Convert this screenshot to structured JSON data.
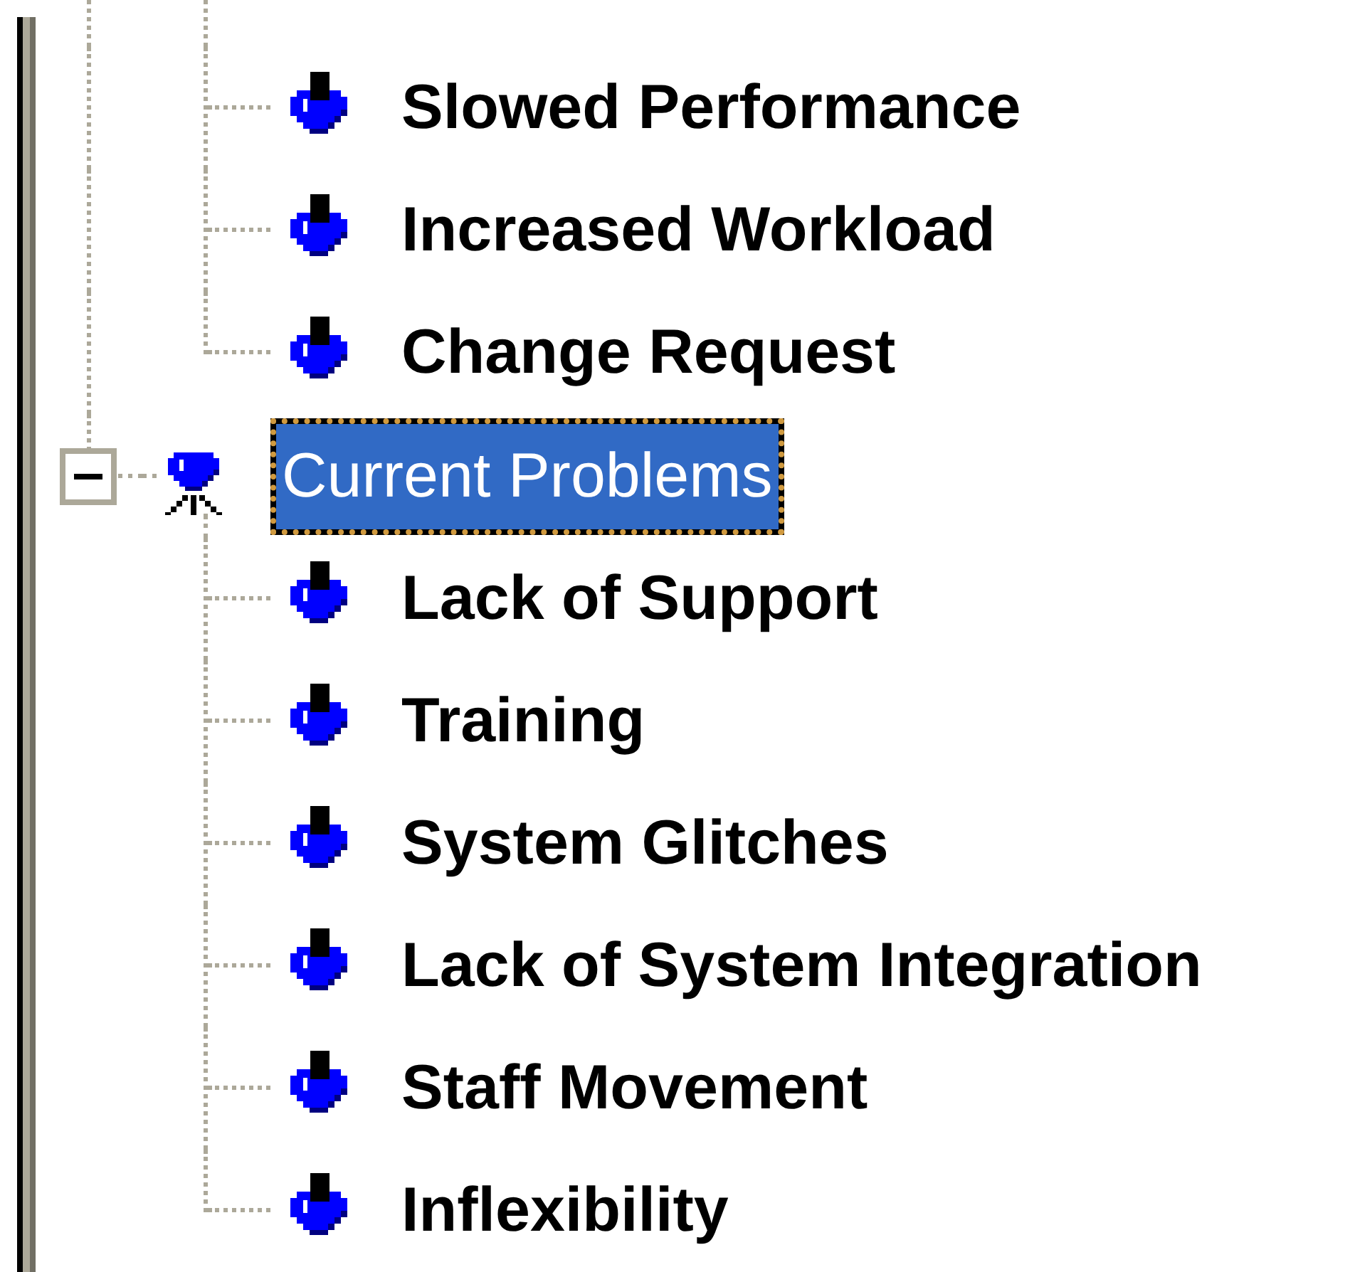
{
  "tree": {
    "nodes": [
      {
        "children": [
          {
            "label": "Slowed Performance",
            "selected": false
          },
          {
            "label": "Increased Workload",
            "selected": false
          },
          {
            "label": "Change Request",
            "selected": false
          }
        ]
      },
      {
        "label": "Current Problems",
        "expanded": true,
        "selected": true,
        "children": [
          {
            "label": "Lack of Support",
            "selected": false
          },
          {
            "label": "Training",
            "selected": false
          },
          {
            "label": "System Glitches",
            "selected": false
          },
          {
            "label": "Lack of System Integration",
            "selected": false
          },
          {
            "label": "Staff Movement",
            "selected": false
          },
          {
            "label": "Inflexibility",
            "selected": false
          }
        ]
      }
    ]
  }
}
